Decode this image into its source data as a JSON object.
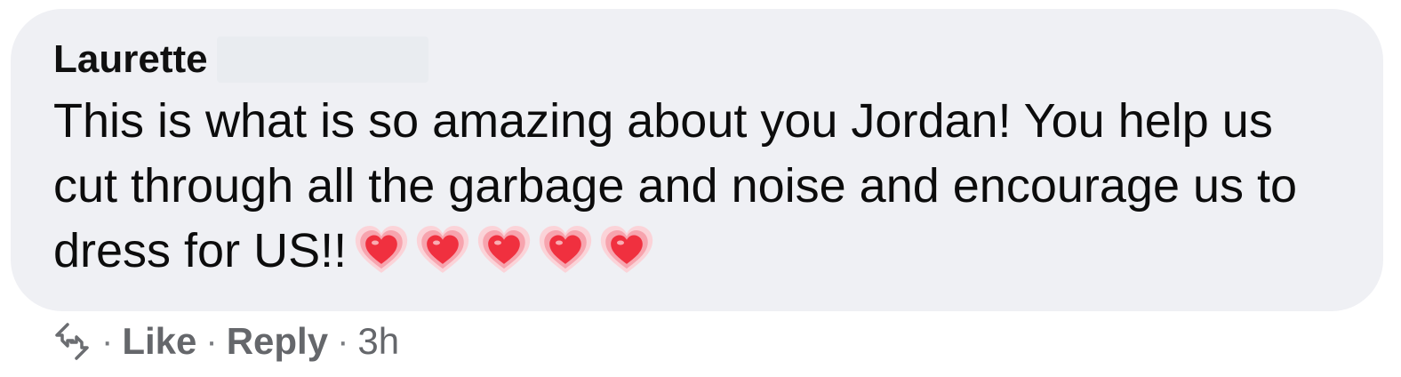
{
  "comment": {
    "author": "Laurette",
    "text": "This is what is so amazing about you Jordan! You help us cut through all the garbage and noise and encourage us to dress for US!!",
    "emoji": [
      "growing-heart",
      "growing-heart",
      "growing-heart",
      "growing-heart",
      "growing-heart"
    ]
  },
  "actions": {
    "share_icon": "share-icon",
    "separator": "·",
    "like_label": "Like",
    "reply_label": "Reply",
    "timestamp": "3h"
  },
  "colors": {
    "bubble": "#eff0f4",
    "heart": "#f0303f",
    "muted_text": "#65676b"
  }
}
